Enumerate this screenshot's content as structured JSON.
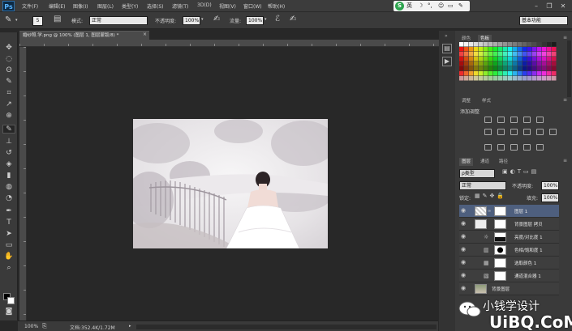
{
  "menubar": {
    "app_logo": "Ps",
    "items": [
      "文件(F)",
      "编辑(E)",
      "图像(I)",
      "图层(L)",
      "类型(Y)",
      "选择(S)",
      "滤镜(T)",
      "3D(D)",
      "视图(V)",
      "窗口(W)",
      "帮助(H)"
    ],
    "ime_char": "英",
    "ime_logo": "S"
  },
  "options": {
    "brush_size": "5",
    "mode_label": "模式:",
    "mode_value": "正常",
    "opacity_label": "不透明度:",
    "opacity_value": "100%",
    "flow_label": "流量:",
    "flow_value": "100%",
    "workspace": "基本功能"
  },
  "document": {
    "tab_title": "婚纱照.学.png @ 100% (图层 1, 图层蒙版/8) *"
  },
  "status": {
    "zoom": "100%",
    "doc_info": "文档:352.4K/1.72M"
  },
  "panels": {
    "color_tabs": [
      "颜色",
      "色板"
    ],
    "adjust_tabs": [
      "调整",
      "样式"
    ],
    "adjust_title": "添加调整",
    "layer_tabs": [
      "图层",
      "通道",
      "路径"
    ],
    "filter_kind": "ρ类型",
    "blend_mode": "正常",
    "opacity_label": "不透明度:",
    "opacity_value": "100%",
    "lock_label": "锁定:",
    "fill_label": "填充:",
    "fill_value": "100%",
    "layers": [
      {
        "name": "图层 1",
        "selected": true
      },
      {
        "name": "背景图层 拷贝",
        "selected": false
      },
      {
        "name": "亮度/对比度 1",
        "selected": false
      },
      {
        "name": "色相/饱和度 1",
        "selected": false
      },
      {
        "name": "选取颜色 1",
        "selected": false
      },
      {
        "name": "通道混合器 1",
        "selected": false
      },
      {
        "name": "背景图层",
        "selected": false
      }
    ]
  },
  "watermark": {
    "line1": "小钱学设计",
    "line2": "UiBQ.CoM"
  }
}
